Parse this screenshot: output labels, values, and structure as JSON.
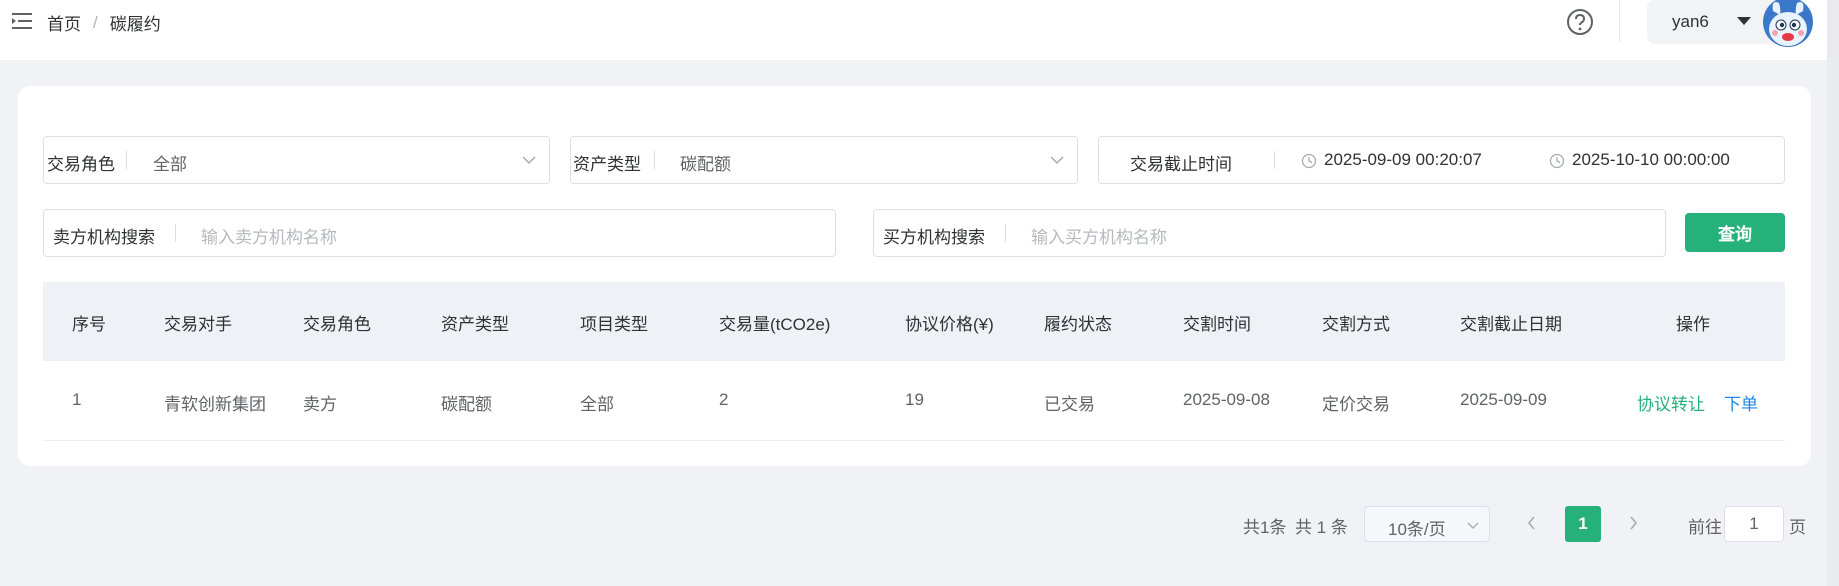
{
  "breadcrumb": {
    "home": "首页",
    "separator": "/",
    "current": "碳履约"
  },
  "user": {
    "name": "yan6"
  },
  "filters": {
    "role": {
      "label": "交易角色",
      "value": "全部"
    },
    "asset": {
      "label": "资产类型",
      "value": "碳配额"
    },
    "deadline": {
      "label": "交易截止时间",
      "start": "2025-09-09 00:20:07",
      "end": "2025-10-10 00:00:00"
    },
    "seller": {
      "label": "卖方机构搜索",
      "placeholder": "输入卖方机构名称"
    },
    "buyer": {
      "label": "买方机构搜索",
      "placeholder": "输入买方机构名称"
    },
    "query_label": "查询"
  },
  "table": {
    "headers": [
      "序号",
      "交易对手",
      "交易角色",
      "资产类型",
      "项目类型",
      "交易量(tCO2e)",
      "协议价格(¥)",
      "履约状态",
      "交割时间",
      "交割方式",
      "交割截止日期",
      "操作"
    ],
    "rows": [
      {
        "index": "1",
        "counterparty": "青软创新集团",
        "role": "卖方",
        "asset": "碳配额",
        "project": "全部",
        "volume": "2",
        "price": "19",
        "status": "已交易",
        "delivery_time": "2025-09-08",
        "delivery_method": "定价交易",
        "deadline": "2025-09-09",
        "action_transfer": "协议转让",
        "action_order": "下单"
      }
    ]
  },
  "pagination": {
    "total_a": "共1条",
    "total_b": "共 1 条",
    "page_size": "10条/页",
    "current_page": "1",
    "goto_label": "前往",
    "goto_value": "1",
    "page_suffix": "页"
  },
  "colors": {
    "accent": "#26b07a",
    "link_blue": "#1e88e5"
  },
  "icons": [
    "menu-fold-icon",
    "help-circle-icon",
    "caret-down-icon",
    "chevron-down-icon",
    "clock-icon",
    "chevron-left-icon",
    "chevron-right-icon"
  ]
}
